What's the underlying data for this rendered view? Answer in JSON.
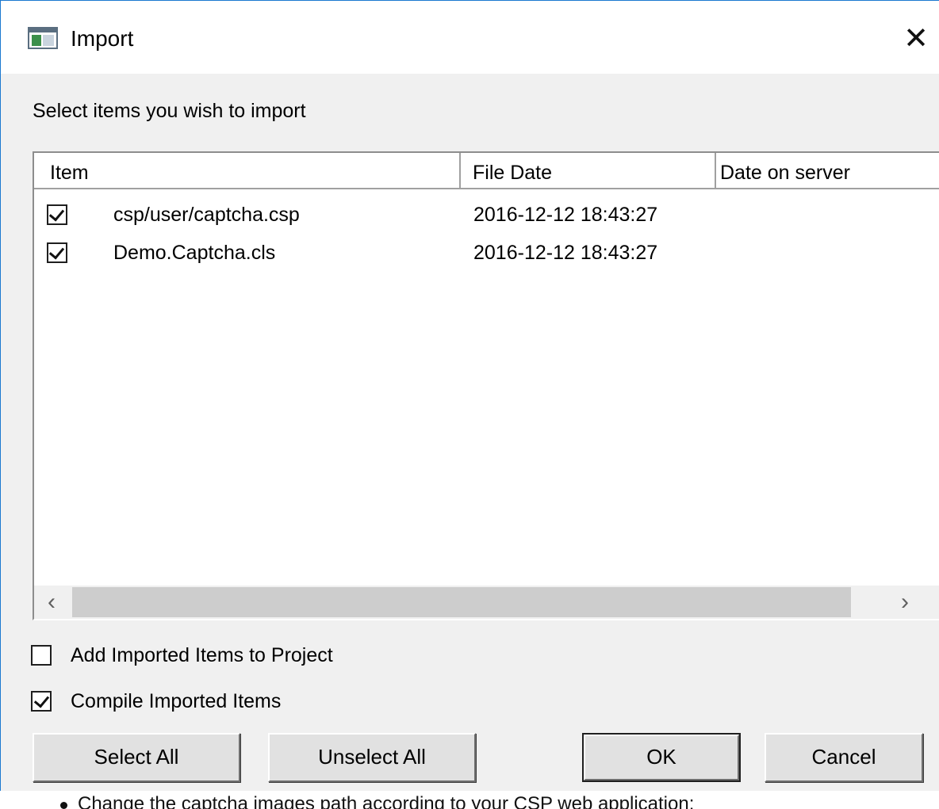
{
  "window": {
    "title": "Import",
    "close_glyph": "✕",
    "icon": "application-window-icon"
  },
  "prompt": "Select items you wish to import",
  "list": {
    "columns": [
      "Item",
      "File Date",
      "Date on server"
    ],
    "rows": [
      {
        "checked": true,
        "item": "csp/user/captcha.csp",
        "file_date": "2016-12-12 18:43:27",
        "server_date": ""
      },
      {
        "checked": true,
        "item": "Demo.Captcha.cls",
        "file_date": "2016-12-12 18:43:27",
        "server_date": ""
      }
    ],
    "scroll_left": "‹",
    "scroll_right": "›"
  },
  "options": {
    "add_to_project": {
      "label": "Add Imported Items to Project",
      "checked": false
    },
    "compile": {
      "label": "Compile Imported Items",
      "checked": true
    }
  },
  "buttons": {
    "select_all": "Select All",
    "unselect_all": "Unselect All",
    "ok": "OK",
    "cancel": "Cancel"
  },
  "background_doc": {
    "line": "Change the captcha images path according to your CSP web application:"
  }
}
